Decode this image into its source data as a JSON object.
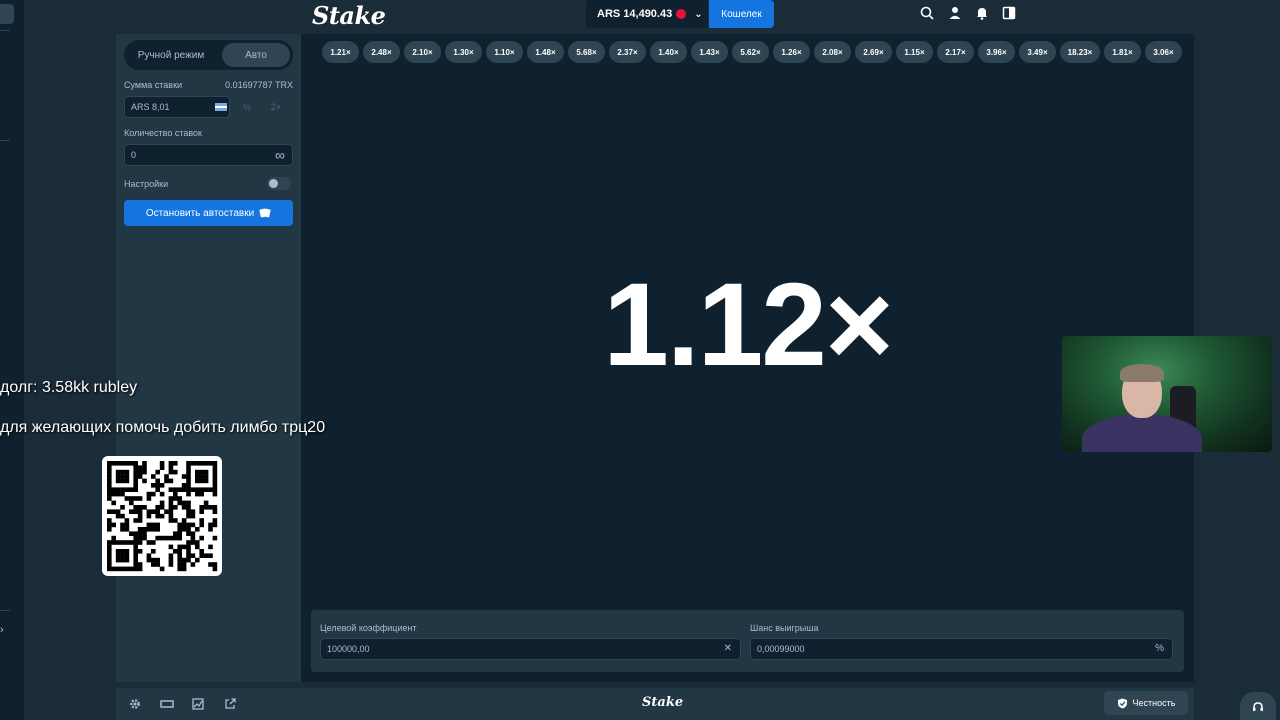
{
  "header": {
    "logo": "Stake",
    "balance": "ARS 14,490.43",
    "wallet_label": "Кошелек"
  },
  "sidebar": {
    "mode_manual": "Ручной режим",
    "mode_auto": "Авто",
    "bet_amount_label": "Сумма ставки",
    "bet_amount_crypto": "0.01697787 TRX",
    "bet_amount_value": "ARS 8,01",
    "half_label": "½",
    "double_label": "2×",
    "num_bets_label": "Количество ставок",
    "num_bets_value": "0",
    "infinity_symbol": "∞",
    "settings_label": "Настройки",
    "stop_autobet_label": "Остановить автоставки"
  },
  "game": {
    "history": [
      "1.21×",
      "2.48×",
      "2.10×",
      "1.30×",
      "1.10×",
      "1.48×",
      "5.68×",
      "2.37×",
      "1.40×",
      "1.43×",
      "5.62×",
      "1.26×",
      "2.08×",
      "2.69×",
      "1.15×",
      "2.17×",
      "3.96×",
      "3.49×",
      "18.23×",
      "1.81×",
      "3.06×"
    ],
    "multiplier": "1.12×",
    "target_label": "Целевой коэффициент",
    "target_value": "100000,00",
    "win_chance_label": "Шанс выигрыша",
    "win_chance_value": "0,00099000",
    "percent_symbol": "%"
  },
  "footer": {
    "logo": "Stake",
    "fairness_label": "Честность"
  },
  "overlay": {
    "debt_text": "долг: 3.58kk rubley",
    "help_text": "для желающих помочь добить лимбо трц20"
  },
  "colors": {
    "bg": "#1a2c38",
    "panel": "#213743",
    "dark": "#0f212e",
    "chip": "#2f4553",
    "accent": "#1475e1"
  }
}
